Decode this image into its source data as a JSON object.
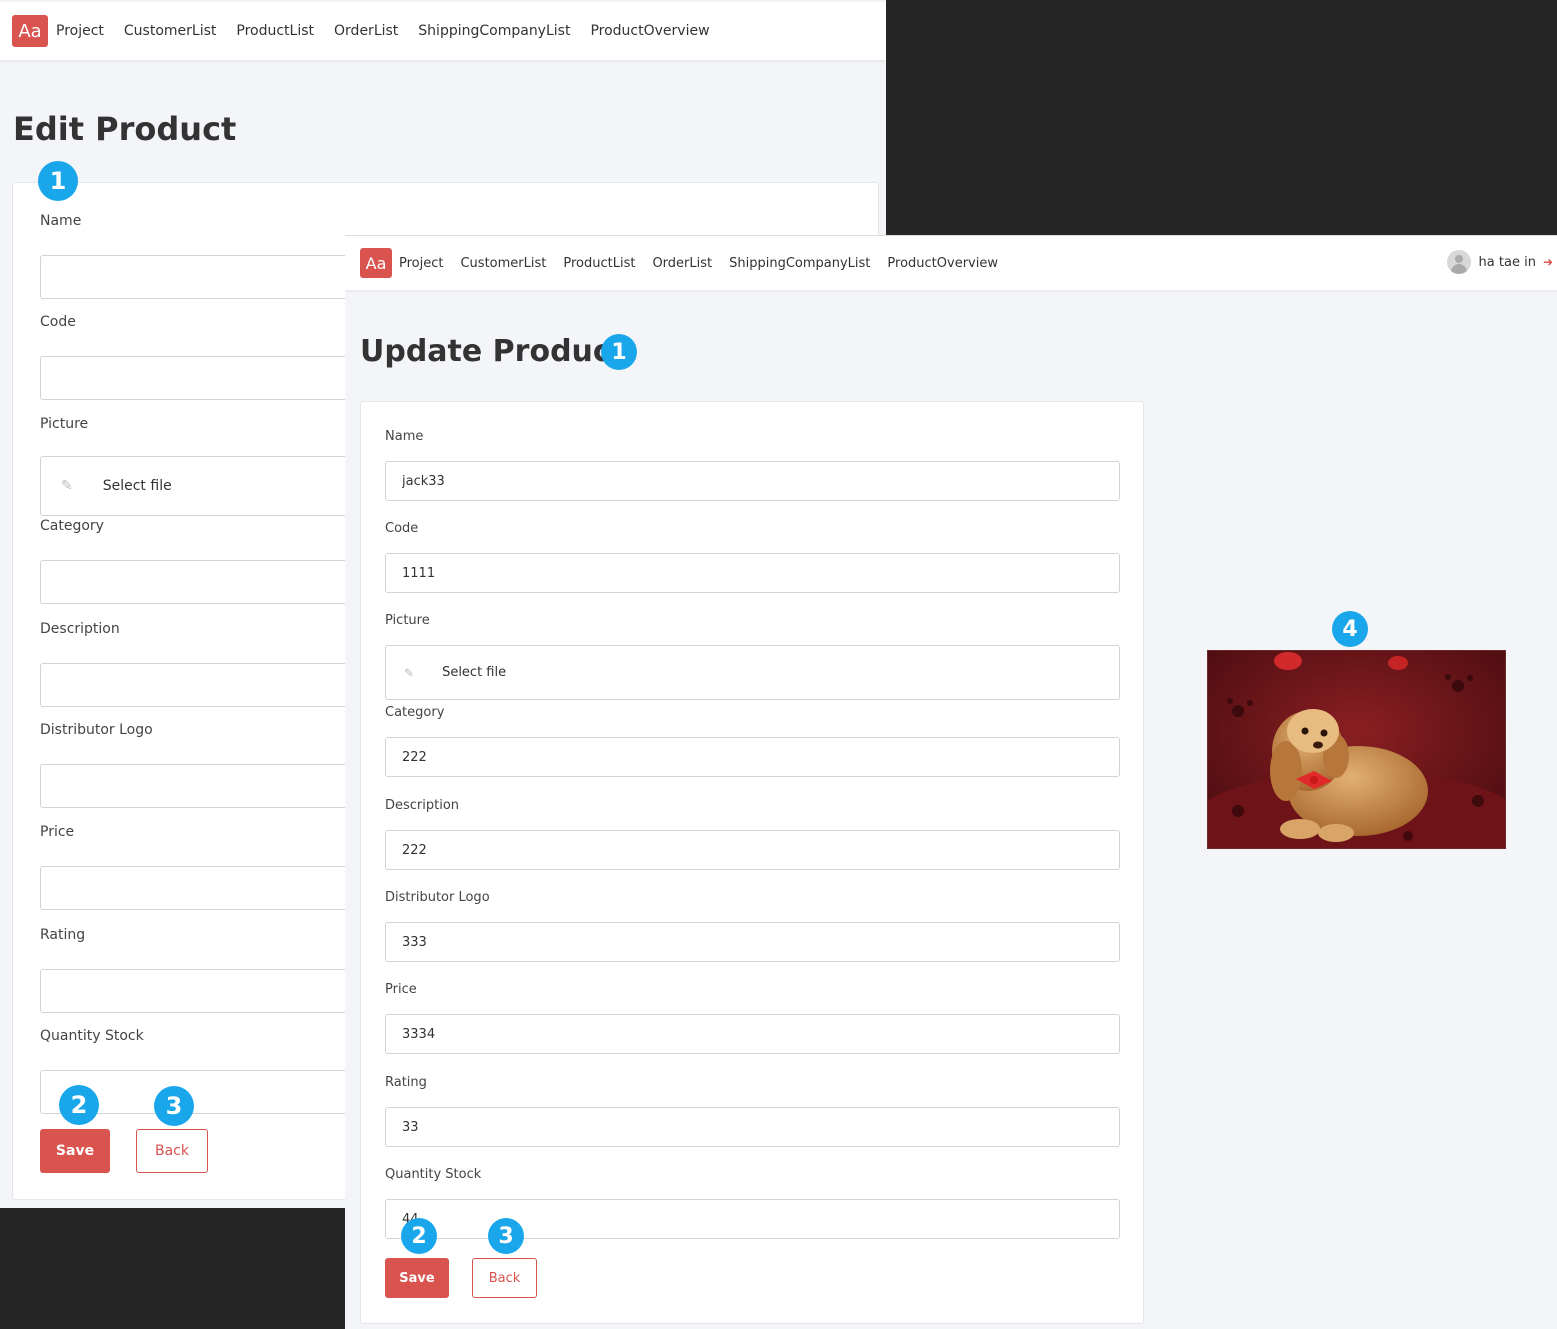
{
  "nav": {
    "logo": "Aa",
    "links": [
      "Project",
      "CustomerList",
      "ProductList",
      "OrderList",
      "ShippingCompanyList",
      "ProductOverview"
    ]
  },
  "user": {
    "name": "ha tae in",
    "logout_icon": "logout-icon"
  },
  "edit_screen": {
    "title": "Edit Product",
    "fields": {
      "name": {
        "label": "Name",
        "value": ""
      },
      "code": {
        "label": "Code",
        "value": ""
      },
      "picture": {
        "label": "Picture",
        "file_placeholder": "Select file"
      },
      "category": {
        "label": "Category",
        "value": ""
      },
      "description": {
        "label": "Description",
        "value": ""
      },
      "distributor_logo": {
        "label": "Distributor Logo",
        "value": ""
      },
      "price": {
        "label": "Price",
        "value": ""
      },
      "rating": {
        "label": "Rating",
        "value": ""
      },
      "quantity_stock": {
        "label": "Quantity Stock",
        "value": ""
      }
    },
    "save_label": "Save",
    "back_label": "Back"
  },
  "update_screen": {
    "title": "Update Product",
    "fields": {
      "name": {
        "label": "Name",
        "value": "jack33"
      },
      "code": {
        "label": "Code",
        "value": "1111"
      },
      "picture": {
        "label": "Picture",
        "file_placeholder": "Select file"
      },
      "category": {
        "label": "Category",
        "value": "222"
      },
      "description": {
        "label": "Description",
        "value": "222"
      },
      "distributor_logo": {
        "label": "Distributor Logo",
        "value": "333"
      },
      "price": {
        "label": "Price",
        "value": "3334"
      },
      "rating": {
        "label": "Rating",
        "value": "33"
      },
      "quantity_stock": {
        "label": "Quantity Stock",
        "value": "44"
      }
    },
    "save_label": "Save",
    "back_label": "Back"
  },
  "markers": {
    "one": "1",
    "two": "2",
    "three": "3",
    "four": "4"
  },
  "colors": {
    "accent": "#d9534f",
    "marker": "#1aa6ea",
    "background": "#f3f5f8"
  }
}
